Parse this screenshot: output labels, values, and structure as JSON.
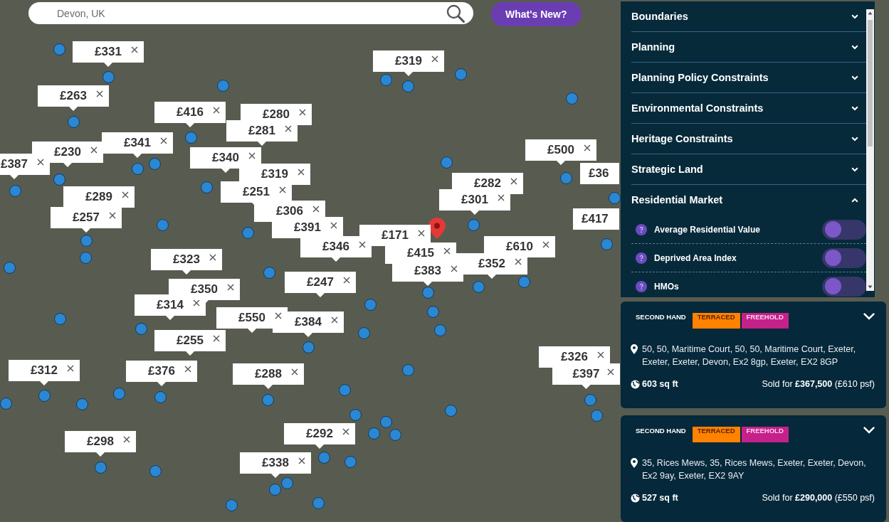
{
  "search": {
    "value": "Devon, UK"
  },
  "whats_new_button": {
    "label": "What's New?"
  },
  "map": {
    "price_popups": [
      {
        "price": "£331"
      },
      {
        "price": "£319"
      },
      {
        "price": "£263"
      },
      {
        "price": "£416"
      },
      {
        "price": "£280"
      },
      {
        "price": "£281"
      },
      {
        "price": "£341"
      },
      {
        "price": "£500"
      },
      {
        "price": "£230"
      },
      {
        "price": "£340"
      },
      {
        "price": "£387"
      },
      {
        "price": "£36"
      },
      {
        "price": "£319"
      },
      {
        "price": "£282"
      },
      {
        "price": "£251"
      },
      {
        "price": "£289"
      },
      {
        "price": "£301"
      },
      {
        "price": "£306"
      },
      {
        "price": "£257"
      },
      {
        "price": "£417"
      },
      {
        "price": "£391"
      },
      {
        "price": "£171"
      },
      {
        "price": "£346"
      },
      {
        "price": "£610"
      },
      {
        "price": "£415"
      },
      {
        "price": "£323"
      },
      {
        "price": "£352"
      },
      {
        "price": "£383"
      },
      {
        "price": "£247"
      },
      {
        "price": "£350"
      },
      {
        "price": "£314"
      },
      {
        "price": "£550"
      },
      {
        "price": "£384"
      },
      {
        "price": "£255"
      },
      {
        "price": "£326"
      },
      {
        "price": "£312"
      },
      {
        "price": "£376"
      },
      {
        "price": "£288"
      },
      {
        "price": "£397"
      },
      {
        "price": "£292"
      },
      {
        "price": "£298"
      },
      {
        "price": "£338"
      }
    ]
  },
  "layers_panel": {
    "sections": [
      {
        "title": "Boundaries",
        "expanded": false
      },
      {
        "title": "Planning",
        "expanded": false
      },
      {
        "title": "Planning Policy Constraints",
        "expanded": false
      },
      {
        "title": "Environmental Constraints",
        "expanded": false
      },
      {
        "title": "Heritage Constraints",
        "expanded": false
      },
      {
        "title": "Strategic Land",
        "expanded": false
      },
      {
        "title": "Residential Market",
        "expanded": true,
        "items": [
          {
            "label": "Average Residential Value",
            "on": false
          },
          {
            "label": "Deprived Area Index",
            "on": false
          },
          {
            "label": "HMOs",
            "on": false
          }
        ]
      }
    ]
  },
  "property_cards": [
    {
      "tags": [
        {
          "label": "SECOND HAND",
          "kind": "plain"
        },
        {
          "label": "TERRACED",
          "kind": "badge",
          "color": "#ff8200"
        },
        {
          "label": "FREEHOLD",
          "kind": "badge",
          "color": "#c4218a"
        }
      ],
      "address": "50, 50, Maritime Court, 50, 50, Maritime Court, Exeter, Exeter, Exeter, Devon, Ex2 8gp, Exeter, EX2 8GP",
      "area": "603 sq ft",
      "sale": "Sold for **£367,500** (£610 psf)"
    },
    {
      "tags": [
        {
          "label": "SECOND HAND",
          "kind": "plain"
        },
        {
          "label": "TERRACED",
          "kind": "badge",
          "color": "#ff8200"
        },
        {
          "label": "FREEHOLD",
          "kind": "badge",
          "color": "#c4218a"
        }
      ],
      "address": "35, Rices Mews, 35, Rices Mews, Exeter, Exeter, Devon, Ex2 9ay, Exeter, EX2 9AY",
      "area": "527 sq ft",
      "sale": "Sold for **£290,000** (£550 psf)"
    }
  ]
}
